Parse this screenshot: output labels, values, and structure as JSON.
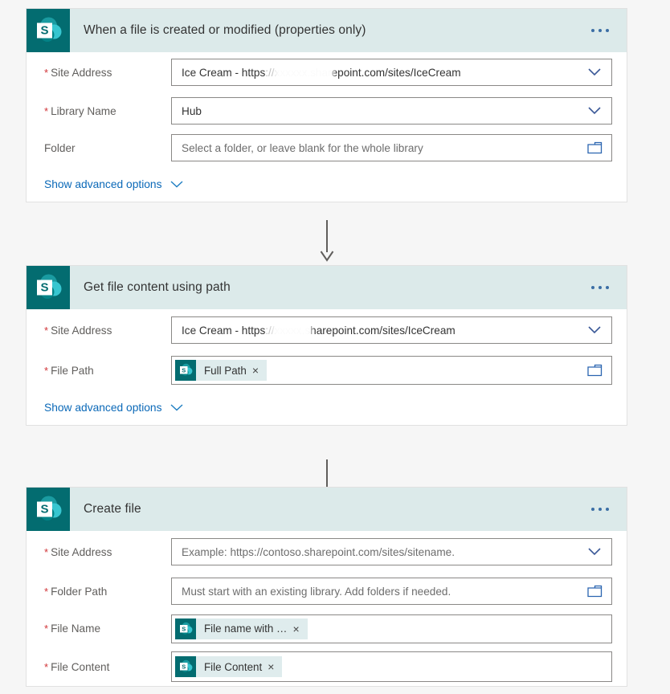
{
  "page": {
    "background": "#f6f6f6",
    "accent_teal": "#036c70",
    "header_band": "#dceaea",
    "link_blue": "#0b69b8",
    "required_red": "#d13438"
  },
  "cards": [
    {
      "id": "when-a-file-is-created-or-modified",
      "title": "When a file is created or modified (properties only)",
      "icon": "sharepoint-icon",
      "menu": "ellipsis-menu",
      "fields": [
        {
          "name": "site-address",
          "label": "Site Address",
          "required": true,
          "type": "dropdown",
          "value_prefix": "Ice Cream - https",
          "value_suffix": "epoint.com/sites/IceCream",
          "redacted": true,
          "icon": "chevron-down-icon"
        },
        {
          "name": "library-name",
          "label": "Library Name",
          "required": true,
          "type": "dropdown",
          "value": "Hub",
          "icon": "chevron-down-icon"
        },
        {
          "name": "folder",
          "label": "Folder",
          "required": false,
          "type": "folder-picker",
          "placeholder": "Select a folder, or leave blank for the whole library",
          "icon": "folder-icon"
        }
      ],
      "advanced_label": "Show advanced options"
    },
    {
      "id": "get-file-content-using-path",
      "title": "Get file content using path",
      "icon": "sharepoint-icon",
      "menu": "ellipsis-menu",
      "fields": [
        {
          "name": "site-address",
          "label": "Site Address",
          "required": true,
          "type": "dropdown",
          "value_prefix": "Ice Cream - https",
          "value_suffix": "harepoint.com/sites/IceCream",
          "redacted": true,
          "icon": "chevron-down-icon"
        },
        {
          "name": "file-path",
          "label": "File Path",
          "required": true,
          "type": "folder-picker",
          "token": {
            "label": "Full Path",
            "icon": "sharepoint-icon",
            "remove": "×"
          },
          "icon": "folder-icon"
        }
      ],
      "advanced_label": "Show advanced options"
    },
    {
      "id": "create-file",
      "title": "Create file",
      "icon": "sharepoint-icon",
      "menu": "ellipsis-menu",
      "fields": [
        {
          "name": "site-address",
          "label": "Site Address",
          "required": true,
          "type": "dropdown",
          "placeholder": "Example: https://contoso.sharepoint.com/sites/sitename.",
          "icon": "chevron-down-icon"
        },
        {
          "name": "folder-path",
          "label": "Folder Path",
          "required": true,
          "type": "folder-picker",
          "placeholder": "Must start with an existing library. Add folders if needed.",
          "icon": "folder-icon"
        },
        {
          "name": "file-name",
          "label": "File Name",
          "required": true,
          "type": "token",
          "token": {
            "label": "File name with …",
            "icon": "sharepoint-icon",
            "remove": "×"
          }
        },
        {
          "name": "file-content",
          "label": "File Content",
          "required": true,
          "type": "token",
          "token": {
            "label": "File Content",
            "icon": "sharepoint-icon",
            "remove": "×"
          }
        }
      ]
    }
  ],
  "connectors": [
    {
      "name": "connector-arrow-1"
    },
    {
      "name": "connector-arrow-2"
    }
  ]
}
